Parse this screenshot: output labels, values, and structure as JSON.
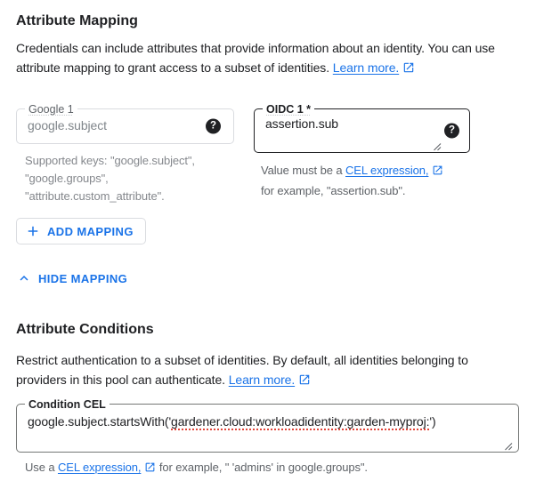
{
  "accent_color": "#1a73e8",
  "error_color": "#e2453a",
  "mapping": {
    "title": "Attribute Mapping",
    "intro_line1": "Credentials can include attributes that provide information about an identity. You can use",
    "intro_line2": "attribute mapping to grant access to a subset of identities.",
    "learn_more": "Learn more.",
    "google_field": {
      "label": "Google 1",
      "value": "google.subject",
      "helper_lines": [
        "Supported keys: \"google.subject\",",
        "\"google.groups\",",
        "\"attribute.custom_attribute\"."
      ]
    },
    "oidc_field": {
      "label": "OIDC 1 *",
      "value": "assertion.sub",
      "helper_prefix": "Value must be a ",
      "helper_link": "CEL expression,",
      "helper_line2": "for example, \"assertion.sub\"."
    },
    "add_button": "ADD MAPPING",
    "hide_button": "HIDE MAPPING"
  },
  "conditions": {
    "title": "Attribute Conditions",
    "intro_line1": "Restrict authentication to a subset of identities. By default, all identities belonging to",
    "intro_line2": "providers in this pool can authenticate.",
    "learn_more": "Learn more.",
    "cel_field": {
      "label": "Condition CEL",
      "value_prefix": "google.subject.startsWith('",
      "value_flagged": "gardener.cloud:workloadidentity:garden-myproj:",
      "value_suffix": "')"
    },
    "footer_prefix": "Use a ",
    "footer_link": "CEL expression,",
    "footer_suffix": " for example, \" 'admins' in google.groups\"."
  }
}
